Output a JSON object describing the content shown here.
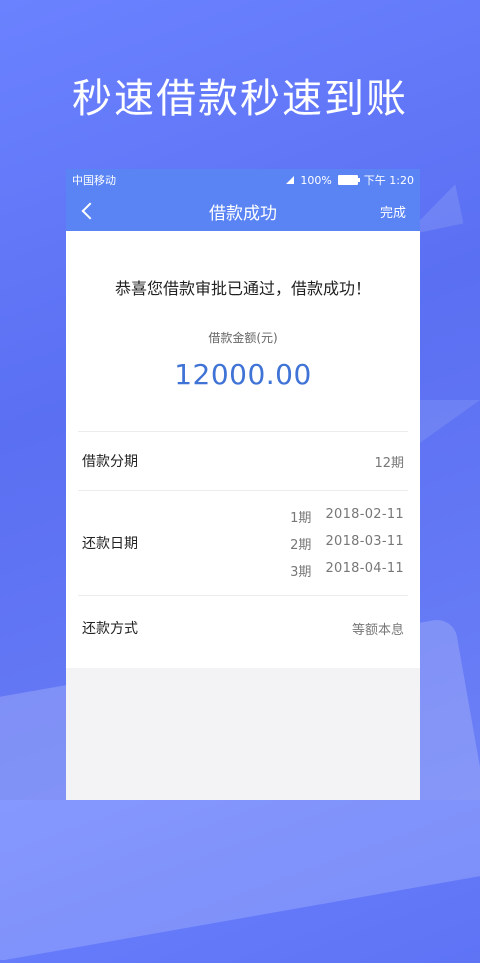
{
  "headline": "秒速借款秒速到账",
  "status_bar": {
    "carrier": "中国移动",
    "battery": "100%",
    "time": "下午 1:20"
  },
  "nav": {
    "title": "借款成功",
    "done_label": "完成"
  },
  "result": {
    "message": "恭喜您借款审批已通过，借款成功！",
    "amount_label": "借款金额(元)",
    "amount_value": "12000.00"
  },
  "details": {
    "term_label": "借款分期",
    "term_value": "12期",
    "dates_label": "还款日期",
    "dates": [
      {
        "period": "1期",
        "date": "2018-02-11"
      },
      {
        "period": "2期",
        "date": "2018-03-11"
      },
      {
        "period": "3期",
        "date": "2018-04-11"
      }
    ],
    "method_label": "还款方式",
    "method_value": "等额本息"
  },
  "colors": {
    "accent": "#5a84f4",
    "amount": "#3f73d6"
  }
}
